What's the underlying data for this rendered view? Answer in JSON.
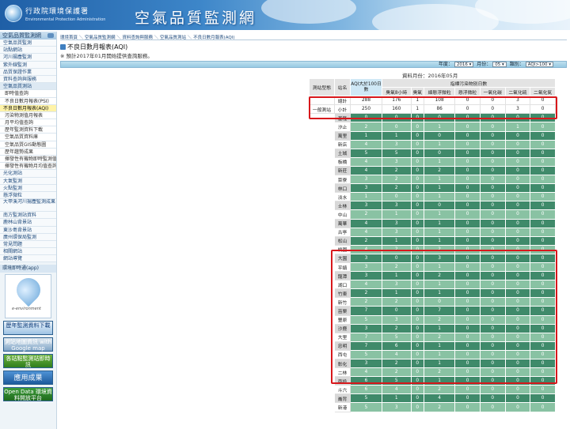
{
  "header": {
    "org_name": "行政院環境保護署",
    "org_sub": "Environmental Protection Administration",
    "site_title": "空氣品質監測網"
  },
  "sidebar": {
    "heading": "空氣品質監測網",
    "items": [
      {
        "label": "空氣品質監測",
        "kind": "item"
      },
      {
        "label": "站點網站",
        "kind": "item"
      },
      {
        "label": "河川揚塵監測",
        "kind": "item"
      },
      {
        "label": "紫外線監測",
        "kind": "item"
      },
      {
        "label": "品質保證作業",
        "kind": "item"
      },
      {
        "label": "資料查詢與服務",
        "kind": "item"
      },
      {
        "label": "空氣品質測站",
        "kind": "group"
      },
      {
        "label": "即時值查詢",
        "kind": "sub"
      },
      {
        "label": "不良日數月報表(PSI)",
        "kind": "sub"
      },
      {
        "label": "不良日數月報表(AQI)",
        "kind": "active"
      },
      {
        "label": "污染物測值月報表",
        "kind": "sub"
      },
      {
        "label": "月平均值查詢",
        "kind": "sub"
      },
      {
        "label": "歷年監測資料下載",
        "kind": "sub"
      },
      {
        "label": "空氣品質資料庫",
        "kind": "sub"
      },
      {
        "label": "空氣品質GIS動態圖",
        "kind": "sub"
      },
      {
        "label": "歷年趨勢成果",
        "kind": "sub"
      },
      {
        "label": "揮發性有機物即時監測值查詢",
        "kind": "sub"
      },
      {
        "label": "揮發性有機物月均值查詢",
        "kind": "sub"
      },
      {
        "label": "光化測站",
        "kind": "item"
      },
      {
        "label": "大氣監測",
        "kind": "item"
      },
      {
        "label": "火點監測",
        "kind": "item"
      },
      {
        "label": "懸浮微粒",
        "kind": "item"
      },
      {
        "label": "大甲溪河川揚塵監測成果",
        "kind": "tall"
      },
      {
        "label": "南方監測站資料",
        "kind": "item"
      },
      {
        "label": "鹿林山背景站",
        "kind": "item"
      },
      {
        "label": "東沙島背景站",
        "kind": "item"
      },
      {
        "label": "廣州環保局監測",
        "kind": "item"
      },
      {
        "label": "常見問題",
        "kind": "item"
      },
      {
        "label": "相關網站",
        "kind": "item"
      },
      {
        "label": "網站導覽",
        "kind": "item"
      }
    ],
    "app_label": "環境即時通(app)",
    "app_caption": "e-environment",
    "banners": [
      {
        "text": "歷年監測資料下載",
        "style": "b1"
      },
      {
        "text": "測站地圖資訊 with Google map",
        "style": "b2"
      },
      {
        "text": "各站點監測站即時訊",
        "style": "b3"
      },
      {
        "text": "應用成果",
        "style": "b4"
      },
      {
        "text": "Open Data 環境資料開放平台",
        "style": "b5"
      }
    ]
  },
  "breadcrumb": [
    "環境首頁",
    "空氣品質監測網",
    "資料查詢與服務",
    "空氣品質測站",
    "不良日數月報表(AQI)"
  ],
  "page_title": "不良日數月報表(AQI)",
  "notice": "※ 預計2017年01月開始提供查詢服務。",
  "filters": {
    "year_label": "年度：",
    "year_value": "2016",
    "month_label": "月份：",
    "month_value": "05",
    "type_label": "類別：",
    "type_value": "AQI>100"
  },
  "data_month": "資料月份：2016年05月",
  "table": {
    "headers": {
      "station_type": "測站型態",
      "site": "站名",
      "aqi_days": "AQI大於100日數",
      "pollutant_group": "指標污染物別日數",
      "cols": [
        "臭氧8小時",
        "臭氧",
        "細懸浮微粒",
        "懸浮微粒",
        "一氧化碳",
        "二氧化硫",
        "二氧化氮"
      ]
    },
    "summary": [
      {
        "type": "",
        "site": "總計",
        "values": [
          "288",
          "176",
          "1",
          "108",
          "0",
          "0",
          "3",
          "0"
        ]
      },
      {
        "type": "一般測站",
        "site": "小計",
        "values": [
          "250",
          "160",
          "1",
          "86",
          "0",
          "0",
          "3",
          "0"
        ]
      }
    ],
    "rows": [
      {
        "site": "基隆",
        "values": [
          "0",
          "0",
          "0",
          "0",
          "0",
          "0",
          "0",
          "0"
        ]
      },
      {
        "site": "汐止",
        "values": [
          "2",
          "0",
          "0",
          "1",
          "0",
          "0",
          "1",
          "0"
        ]
      },
      {
        "site": "萬里",
        "values": [
          "1",
          "1",
          "0",
          "0",
          "0",
          "0",
          "0",
          "0"
        ]
      },
      {
        "site": "新店",
        "values": [
          "4",
          "3",
          "0",
          "1",
          "0",
          "0",
          "0",
          "0"
        ]
      },
      {
        "site": "土城",
        "values": [
          "5",
          "5",
          "0",
          "0",
          "0",
          "0",
          "0",
          "0"
        ]
      },
      {
        "site": "板橋",
        "values": [
          "4",
          "3",
          "0",
          "1",
          "0",
          "0",
          "0",
          "0"
        ]
      },
      {
        "site": "新莊",
        "values": [
          "4",
          "2",
          "0",
          "2",
          "0",
          "0",
          "0",
          "0"
        ]
      },
      {
        "site": "菜寮",
        "values": [
          "3",
          "2",
          "0",
          "1",
          "0",
          "0",
          "0",
          "0"
        ]
      },
      {
        "site": "林口",
        "values": [
          "3",
          "2",
          "0",
          "1",
          "0",
          "0",
          "0",
          "0"
        ]
      },
      {
        "site": "淡水",
        "values": [
          "1",
          "0",
          "0",
          "1",
          "0",
          "0",
          "0",
          "0"
        ]
      },
      {
        "site": "士林",
        "values": [
          "3",
          "3",
          "0",
          "0",
          "0",
          "0",
          "0",
          "0"
        ]
      },
      {
        "site": "中山",
        "values": [
          "2",
          "1",
          "0",
          "1",
          "0",
          "0",
          "0",
          "0"
        ]
      },
      {
        "site": "萬華",
        "values": [
          "4",
          "3",
          "0",
          "1",
          "0",
          "0",
          "0",
          "0"
        ]
      },
      {
        "site": "古亭",
        "values": [
          "4",
          "3",
          "0",
          "1",
          "0",
          "0",
          "0",
          "0"
        ]
      },
      {
        "site": "松山",
        "values": [
          "2",
          "1",
          "0",
          "1",
          "0",
          "0",
          "0",
          "0"
        ]
      },
      {
        "site": "桃園",
        "values": [
          "4",
          "2",
          "0",
          "2",
          "0",
          "0",
          "0",
          "0"
        ]
      },
      {
        "site": "大園",
        "values": [
          "3",
          "0",
          "0",
          "3",
          "0",
          "0",
          "0",
          "0"
        ]
      },
      {
        "site": "平鎮",
        "values": [
          "3",
          "2",
          "0",
          "1",
          "0",
          "0",
          "0",
          "0"
        ]
      },
      {
        "site": "龍潭",
        "values": [
          "3",
          "1",
          "0",
          "2",
          "0",
          "0",
          "0",
          "0"
        ]
      },
      {
        "site": "湖口",
        "values": [
          "4",
          "3",
          "0",
          "1",
          "0",
          "0",
          "0",
          "0"
        ]
      },
      {
        "site": "竹東",
        "values": [
          "2",
          "1",
          "0",
          "1",
          "0",
          "0",
          "0",
          "0"
        ]
      },
      {
        "site": "新竹",
        "values": [
          "2",
          "2",
          "0",
          "0",
          "0",
          "0",
          "0",
          "0"
        ]
      },
      {
        "site": "苗栗",
        "values": [
          "7",
          "0",
          "0",
          "7",
          "0",
          "0",
          "0",
          "0"
        ]
      },
      {
        "site": "豐原",
        "values": [
          "5",
          "3",
          "0",
          "2",
          "0",
          "0",
          "0",
          "0"
        ]
      },
      {
        "site": "沙鹿",
        "values": [
          "3",
          "2",
          "0",
          "1",
          "0",
          "0",
          "0",
          "0"
        ]
      },
      {
        "site": "大里",
        "values": [
          "7",
          "5",
          "0",
          "2",
          "0",
          "0",
          "0",
          "0"
        ]
      },
      {
        "site": "忠明",
        "values": [
          "7",
          "6",
          "0",
          "1",
          "0",
          "0",
          "0",
          "0"
        ]
      },
      {
        "site": "西屯",
        "values": [
          "5",
          "4",
          "0",
          "1",
          "0",
          "0",
          "0",
          "0"
        ]
      },
      {
        "site": "彰化",
        "values": [
          "3",
          "2",
          "0",
          "1",
          "0",
          "0",
          "0",
          "0"
        ]
      },
      {
        "site": "二林",
        "values": [
          "4",
          "2",
          "0",
          "2",
          "0",
          "0",
          "0",
          "0"
        ]
      },
      {
        "site": "南投",
        "values": [
          "6",
          "5",
          "0",
          "1",
          "0",
          "0",
          "0",
          "0"
        ]
      },
      {
        "site": "斗六",
        "values": [
          "6",
          "4",
          "0",
          "2",
          "0",
          "0",
          "0",
          "0"
        ]
      },
      {
        "site": "崙背",
        "values": [
          "5",
          "1",
          "0",
          "4",
          "0",
          "0",
          "0",
          "0"
        ]
      },
      {
        "site": "新港",
        "values": [
          "5",
          "3",
          "0",
          "2",
          "0",
          "0",
          "0",
          "0"
        ]
      }
    ]
  },
  "highlight_color": "#d8181c"
}
